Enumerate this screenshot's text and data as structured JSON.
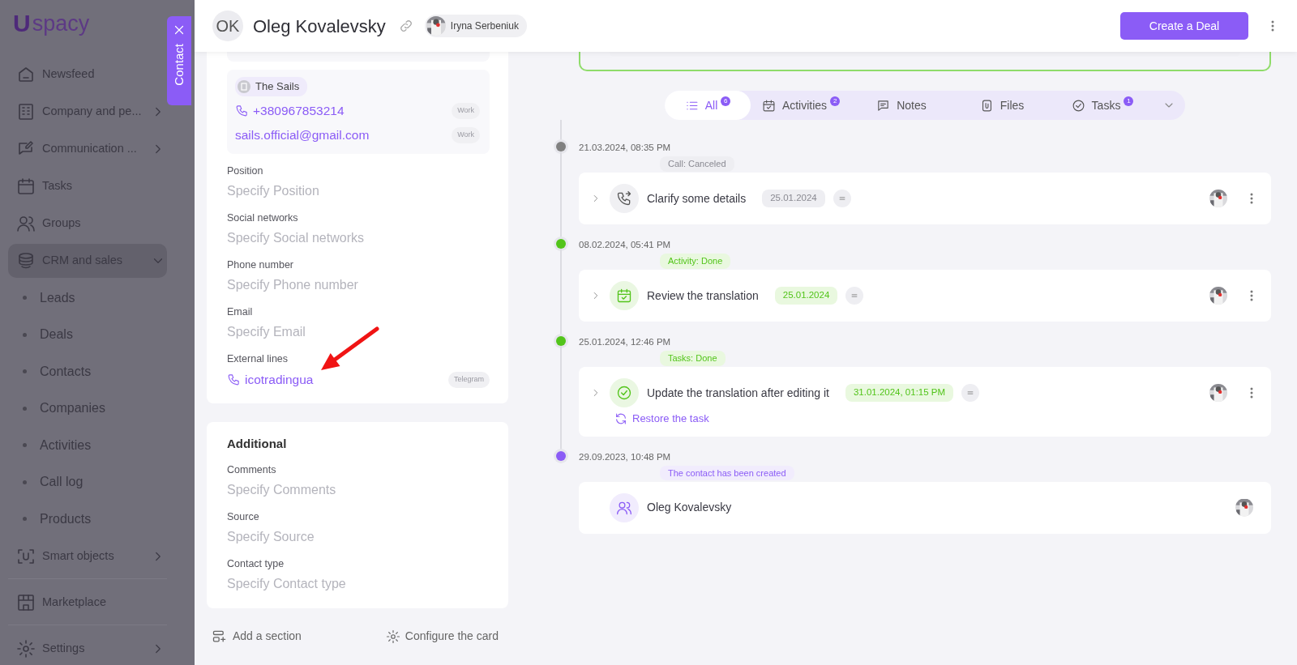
{
  "sidebar": {
    "logo": {
      "mark": "U",
      "text": "spacy"
    },
    "items": [
      {
        "label": "Newsfeed",
        "selected": false
      },
      {
        "label": "Company and pe...",
        "selected": false,
        "expanded": false
      },
      {
        "label": "Communication ...",
        "selected": false,
        "expanded": false
      },
      {
        "label": "Tasks",
        "selected": false
      },
      {
        "label": "Groups",
        "selected": false
      },
      {
        "label": "CRM and sales",
        "selected": true,
        "expanded": true,
        "children": [
          {
            "label": "Leads",
            "selected": false
          },
          {
            "label": "Deals",
            "selected": false
          },
          {
            "label": "Contacts",
            "selected": false
          },
          {
            "label": "Companies",
            "selected": false
          },
          {
            "label": "Activities",
            "selected": false
          },
          {
            "label": "Call log",
            "selected": false
          },
          {
            "label": "Products",
            "selected": false
          }
        ]
      },
      {
        "label": "Smart objects",
        "selected": false,
        "expanded": false
      },
      {
        "label": "Marketplace",
        "selected": false,
        "divider_before": true
      },
      {
        "label": "Settings",
        "selected": false,
        "expanded": false,
        "divider_before": true
      }
    ]
  },
  "contact_tab": {
    "label": "Contact"
  },
  "header": {
    "initials": "OK",
    "name": "Oleg Kovalevsky",
    "responsible": {
      "name": "Iryna Serbeniuk"
    },
    "primary_button": "Create a Deal"
  },
  "contact_card": {
    "company": {
      "name": "The Sails",
      "contacts": [
        {
          "kind": "phone",
          "value": "+380967853214",
          "tag": "Work"
        },
        {
          "kind": "email",
          "value": "sails.official@gmail.com",
          "tag": "Work"
        }
      ]
    },
    "fields": [
      {
        "kind": "empty",
        "label": "Position",
        "placeholder": "Specify Position"
      },
      {
        "kind": "empty",
        "label": "Social networks",
        "placeholder": "Specify Social networks"
      },
      {
        "kind": "empty",
        "label": "Phone number",
        "placeholder": "Specify Phone number"
      },
      {
        "kind": "empty",
        "label": "Email",
        "placeholder": "Specify Email"
      },
      {
        "kind": "contact",
        "label": "External lines",
        "value": "icotradingua",
        "tag": "Telegram"
      }
    ]
  },
  "additional": {
    "title": "Additional",
    "fields": [
      {
        "kind": "empty",
        "label": "Comments",
        "placeholder": "Specify Comments"
      },
      {
        "kind": "empty",
        "label": "Source",
        "placeholder": "Specify Source"
      },
      {
        "kind": "empty",
        "label": "Contact type",
        "placeholder": "Specify Contact type"
      }
    ]
  },
  "footer_actions": [
    {
      "kind": "add",
      "label": "Add a section"
    },
    {
      "kind": "settings",
      "label": "Configure the card"
    }
  ],
  "timeline": {
    "filters": [
      {
        "label": "All",
        "count": "6",
        "selected": true
      },
      {
        "label": "Activities",
        "count": "2",
        "selected": false
      },
      {
        "label": "Notes",
        "selected": false
      },
      {
        "label": "Files",
        "selected": false
      },
      {
        "label": "Tasks",
        "count": "1",
        "selected": false
      }
    ],
    "events": [
      {
        "date": "21.03.2024, 08:35 PM",
        "color": "#808080",
        "kind": "call",
        "status": "Call: Canceled",
        "title": "Clarify some details",
        "due": "25.01.2024"
      },
      {
        "date": "08.02.2024, 05:41 PM",
        "color": "#52c41a",
        "kind": "activity",
        "status": "Activity: Done",
        "title": "Review the translation",
        "due": "25.01.2024"
      },
      {
        "date": "25.01.2024, 12:46 PM",
        "color": "#52c41a",
        "kind": "task",
        "status": "Tasks: Done",
        "title": "Update the translation after editing it",
        "due": "31.01.2024, 01:15 PM",
        "action": "Restore the task"
      },
      {
        "date": "29.09.2023, 10:48 PM",
        "color": "#8b5cf6",
        "kind": "created",
        "status": "The contact has been created",
        "title": "Oleg Kovalevsky"
      }
    ]
  }
}
